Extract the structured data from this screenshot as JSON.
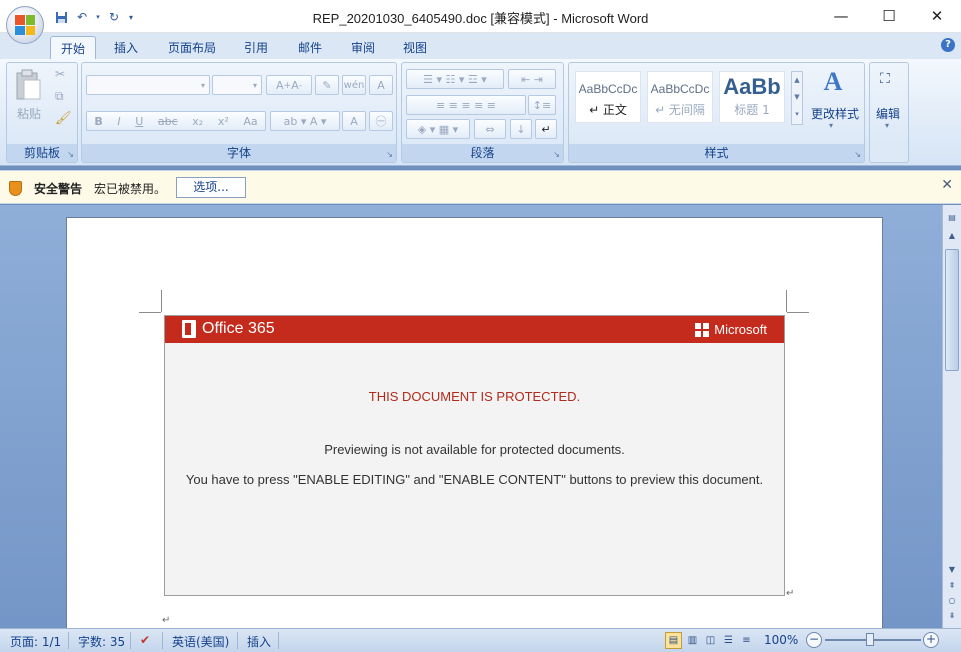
{
  "window": {
    "title": "REP_20201030_6405490.doc [兼容模式] - Microsoft Word",
    "minimize_icon": "—",
    "maximize_icon": "☐",
    "close_icon": "✕"
  },
  "qat": {
    "save_icon": "save-icon",
    "undo_icon": "undo-icon",
    "redo_icon": "redo-icon"
  },
  "tabs": [
    {
      "label": "开始",
      "active": true
    },
    {
      "label": "插入"
    },
    {
      "label": "页面布局"
    },
    {
      "label": "引用"
    },
    {
      "label": "邮件"
    },
    {
      "label": "审阅"
    },
    {
      "label": "视图"
    }
  ],
  "ribbon": {
    "clipboard": {
      "paste_label": "粘贴",
      "group_label": "剪贴板"
    },
    "font": {
      "group_label": "字体"
    },
    "paragraph": {
      "group_label": "段落"
    },
    "styles": {
      "group_label": "样式",
      "items": [
        {
          "preview": "AaBbCcDc",
          "name": "↵ 正文"
        },
        {
          "preview": "AaBbCcDc",
          "name": "↵ 无间隔"
        },
        {
          "preview": "AaBb",
          "name": "标题 1"
        }
      ],
      "change_styles_label": "更改样式"
    },
    "editing": {
      "label": "编辑"
    }
  },
  "security_bar": {
    "title": "安全警告",
    "message": "宏已被禁用。",
    "options_button": "选项..."
  },
  "document": {
    "office_brand": "Office 365",
    "microsoft_brand": "Microsoft",
    "heading": "THIS DOCUMENT IS PROTECTED.",
    "line1": "Previewing is not available for protected documents.",
    "line2": "You have to press \"ENABLE EDITING\" and \"ENABLE CONTENT\" buttons to preview this document.",
    "paragraph_mark": "↵"
  },
  "status_bar": {
    "page": "页面: 1/1",
    "words": "字数: 35",
    "language": "英语(美国)",
    "mode": "插入",
    "zoom": "100%"
  },
  "colors": {
    "banner_red": "#c42b1c",
    "heading_red": "#b22a1c",
    "ribbon_blue": "#dbe7f5"
  }
}
